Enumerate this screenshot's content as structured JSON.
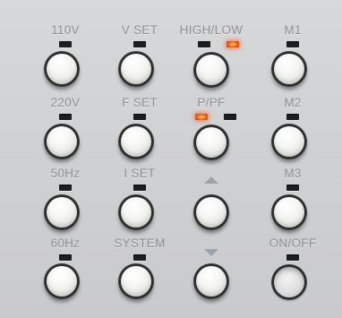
{
  "panel": {
    "row1": {
      "col1_label": "110V",
      "col2_label": "V SET",
      "col3_label": "HIGH/LOW",
      "col4_label": "M1"
    },
    "row2": {
      "col1_label": "220V",
      "col2_label": "F SET",
      "col3_label": "P/PF",
      "col4_label": "M2"
    },
    "row3": {
      "col1_label": "50Hz",
      "col2_label": "I SET",
      "col3_icon": "arrow-up-icon",
      "col4_label": "M3"
    },
    "row4": {
      "col1_label": "60Hz",
      "col2_label": "SYSTEM",
      "col3_icon": "arrow-down-icon",
      "col4_label": "ON/OFF"
    },
    "indicators_lit": [
      "high-low-led-2",
      "p-pf-led-1"
    ],
    "colors": {
      "panel": "#d2d3d5",
      "label": "#8c8f94",
      "led_off": "#1d1e20",
      "led_on": "#ff5a1f",
      "button": "#f4f4f2"
    }
  }
}
